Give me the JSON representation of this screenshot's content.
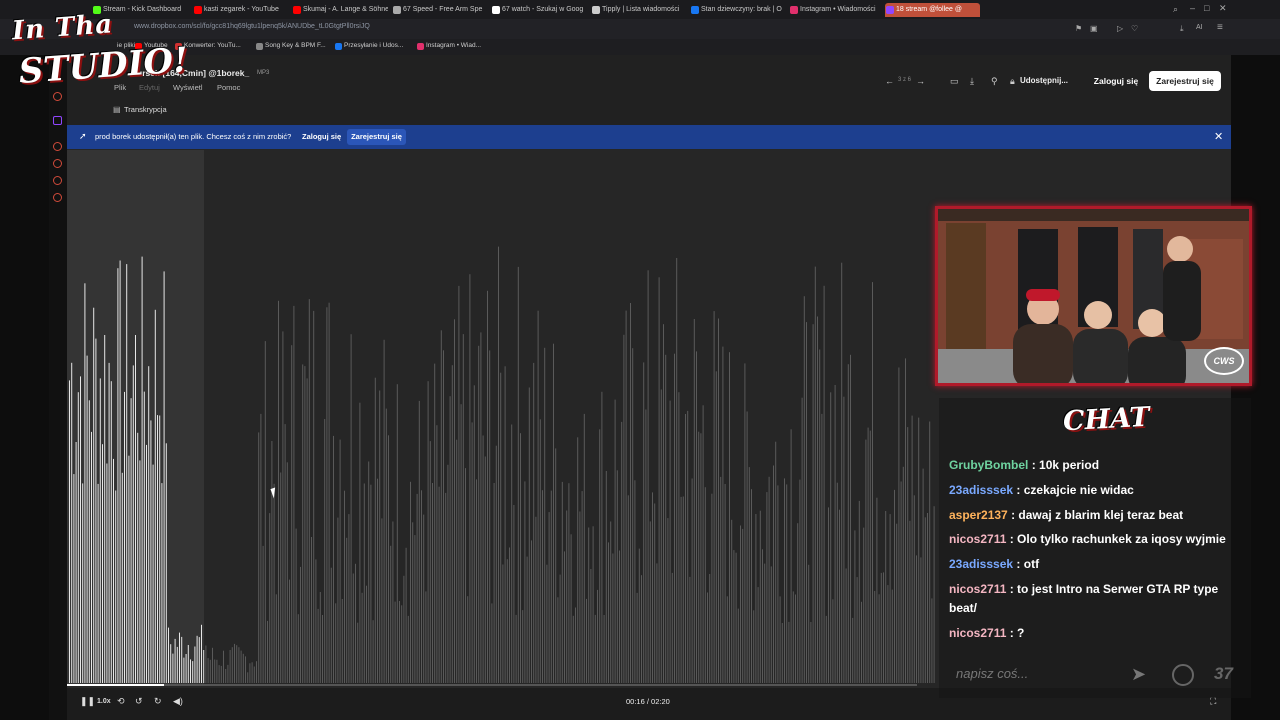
{
  "browser": {
    "tabs": [
      {
        "title": "Stream - Kick Dashboard",
        "color": "#53fc18"
      },
      {
        "title": "kasti zegarek - YouTube",
        "color": "#ff0000"
      },
      {
        "title": "Skumaj - A. Lange & Söhne",
        "color": "#ff0000"
      },
      {
        "title": "67 Speed - Free Arm Spe",
        "color": "#aaaaaa"
      },
      {
        "title": "67 watch - Szukaj w Goog",
        "color": "#ffffff"
      },
      {
        "title": "Tipply | Lista wiadomości",
        "color": "#cccccc"
      },
      {
        "title": "Stan dziewczyny: brak | O",
        "color": "#1877f2"
      },
      {
        "title": "Instagram • Wiadomości",
        "color": "#e1306c"
      },
      {
        "title": "18 stream @follee @",
        "color": "#9146ff"
      }
    ],
    "url": "www.dropbox.com/scl/fo/gcc81hq69lgtu1lpenq5k/ANUDbe_tL0GtgtPll0rsiJQ",
    "bookmarks": [
      {
        "title": "Youtube",
        "color": "#ff0000"
      },
      {
        "title": "Konwerter: YouTu...",
        "color": "#d03030"
      },
      {
        "title": "Song Key & BPM F...",
        "color": "#888888"
      },
      {
        "title": "Przesyłanie i Udos...",
        "color": "#1877f2"
      },
      {
        "title": "Instagram • Wiad...",
        "color": "#e1306c"
      }
    ],
    "bookmarks_prefix": "ie pliki"
  },
  "logo": {
    "line1": "In Tha",
    "line2": "STUDIO!"
  },
  "dropbox": {
    "file_title": "urself [164,Cmin] @1borek_",
    "file_type": "MP3",
    "menu": [
      "Plik",
      "Edytuj",
      "Wyświetl",
      "Pomoc"
    ],
    "transcription_label": "Transkrypcja",
    "page_indicator": "3 z 6",
    "share_label": "Udostępnij...",
    "login_label": "Zaloguj się",
    "signup_label": "Zarejestruj się",
    "banner": {
      "text": "prod borek udostępnił(a) ten plik. Chcesz coś z nim zrobić?",
      "login": "Zaloguj się",
      "signup": "Zarejestruj się"
    }
  },
  "player": {
    "speed": "1.0x",
    "time_current": "00:16",
    "time_total": "02:20",
    "progress_fraction": 0.114
  },
  "webcam": {
    "badge": "CWS"
  },
  "chat": {
    "title": "CHAT",
    "messages": [
      {
        "user": "GrubyBombel",
        "text": ": 10k period",
        "color": "#6fd3a0"
      },
      {
        "user": "23adisssek",
        "text": ": czekajcie nie widac",
        "color": "#7aa9ff"
      },
      {
        "user": "asper2137",
        "text": ": dawaj z blarim klej teraz beat",
        "color": "#ffb35c"
      },
      {
        "user": "nicos2711",
        "text": ": Olo tylko rachunkek za iqosy wyjmie",
        "color": "#f4b6c2"
      },
      {
        "user": "23adisssek",
        "text": ": otf",
        "color": "#7aa9ff"
      },
      {
        "user": "nicos2711",
        "text": ": to jest Intro na Serwer GTA RP type beat/",
        "color": "#f4b6c2"
      },
      {
        "user": "nicos2711",
        "text": ": ?",
        "color": "#f4b6c2"
      }
    ],
    "input_placeholder": "napisz coś...",
    "counter": "37"
  }
}
